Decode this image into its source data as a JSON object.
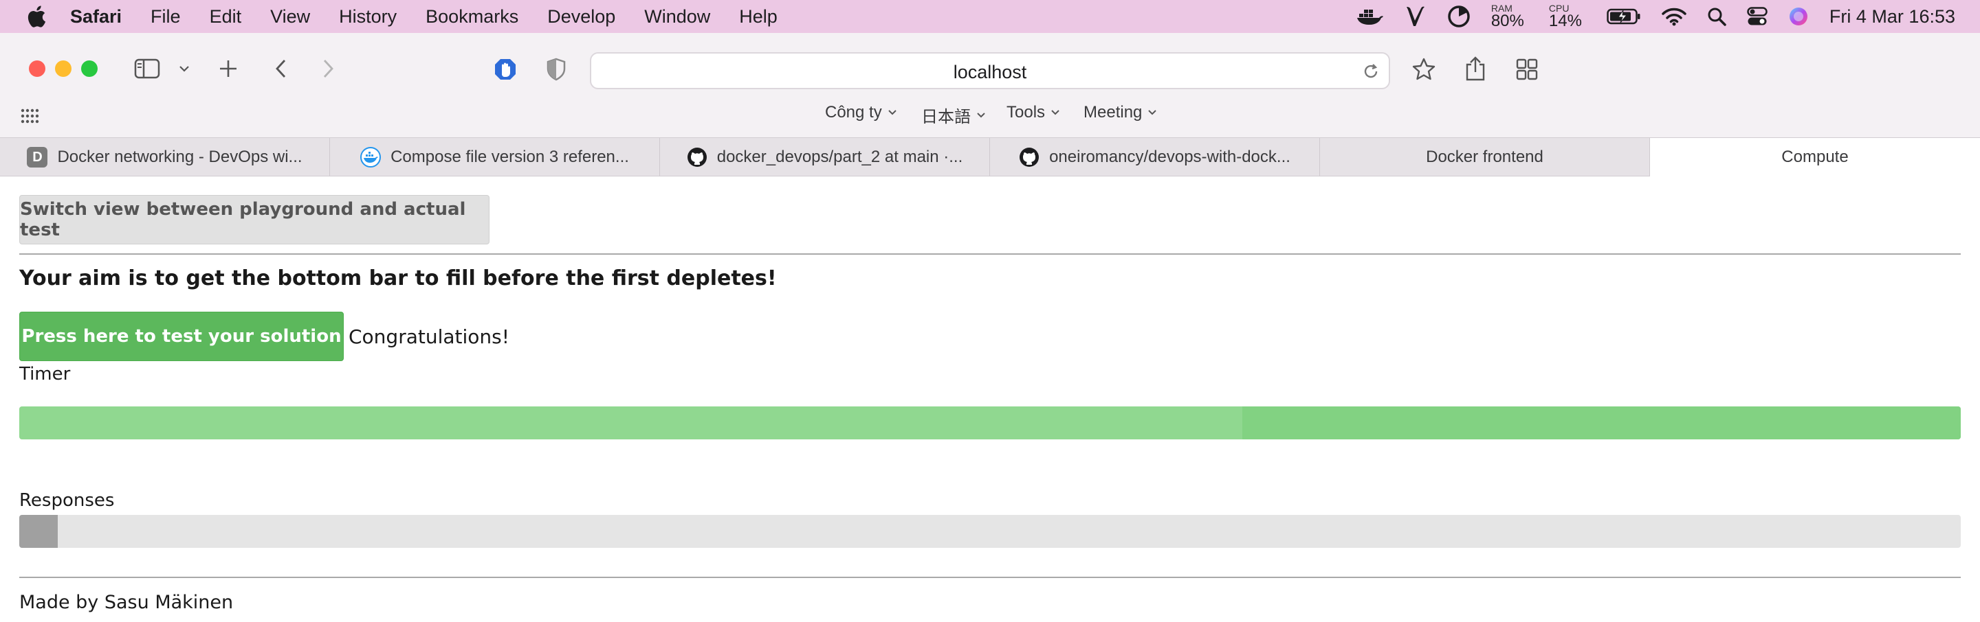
{
  "menubar": {
    "app": "Safari",
    "items": [
      "File",
      "Edit",
      "View",
      "History",
      "Bookmarks",
      "Develop",
      "Window",
      "Help"
    ],
    "ram_label": "RAM",
    "ram_value": "80%",
    "cpu_label": "CPU",
    "cpu_value": "14%",
    "clock": "Fri 4 Mar  16:53"
  },
  "toolbar": {
    "url": "localhost"
  },
  "favorites": [
    "Công ty",
    "日本語",
    "Tools",
    "Meeting"
  ],
  "tabs": [
    {
      "title": "Docker networking - DevOps wi...",
      "icon": "letter-d-icon"
    },
    {
      "title": "Compose file version 3 referen...",
      "icon": "docker-icon"
    },
    {
      "title": "docker_devops/part_2 at main ·...",
      "icon": "github-icon"
    },
    {
      "title": "oneiromancy/devops-with-dock...",
      "icon": "github-icon"
    },
    {
      "title": "Docker frontend",
      "icon": ""
    },
    {
      "title": "Compute",
      "icon": ""
    }
  ],
  "page": {
    "switch_button": "Switch view between playground and actual test",
    "aim": "Your aim is to get the bottom bar to fill before the first depletes!",
    "test_button": "Press here to test your solution",
    "result": "Congratulations!",
    "timer_label": "Timer",
    "timer_progress": 1.0,
    "responses_label": "Responses",
    "responses_progress": 0.02,
    "footer": "Made by Sasu Mäkinen"
  },
  "colors": {
    "menubar_bg": "#ecc8e4",
    "timer_fill": "#90d890",
    "test_button": "#5cb85c",
    "switch_button": "#e1e1e1"
  }
}
